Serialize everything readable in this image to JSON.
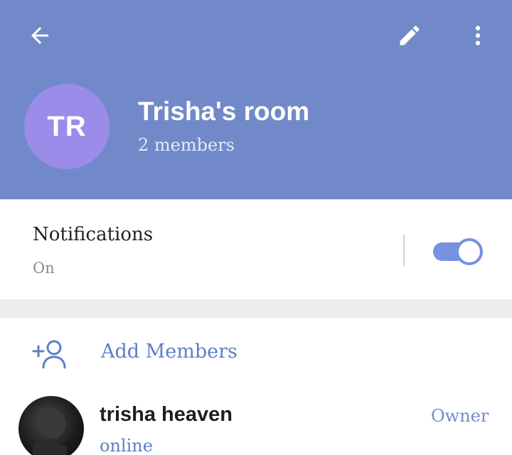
{
  "colors": {
    "header_bg": "#7289c9",
    "accent": "#5d7fc7",
    "avatar_bg": "#9b8cea",
    "toggle": "#7492e0"
  },
  "header": {
    "back_icon": "arrow-left-icon",
    "edit_icon": "pencil-icon",
    "more_icon": "more-vertical-icon",
    "avatar_initials": "TR",
    "title": "Trisha's room",
    "subtitle": "2 members"
  },
  "notifications": {
    "label": "Notifications",
    "value": "On",
    "toggle_on": true
  },
  "add_members": {
    "icon": "add-person-icon",
    "label": "Add Members"
  },
  "members": [
    {
      "name": "trisha heaven",
      "status": "online",
      "role": "Owner"
    }
  ]
}
